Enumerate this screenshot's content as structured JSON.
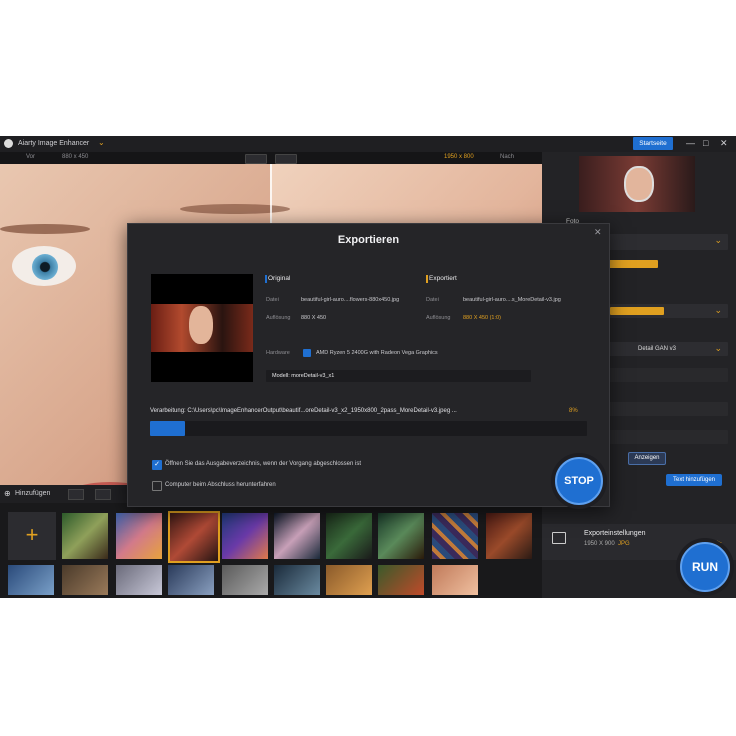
{
  "app": {
    "title": "Aiarty Image Enhancer",
    "start_button": "Startseite",
    "window_controls": [
      "—",
      "□",
      "✕"
    ]
  },
  "viewbar": {
    "left_tab": "Vor",
    "left_size": "880 x 450",
    "right_size": "1950 x 800",
    "right_tab": "Nach"
  },
  "right_panel": {
    "photo_label": "Foto",
    "dropdowns": [
      "",
      "",
      "",
      ""
    ],
    "yellow_tags": [
      "",
      "",
      ""
    ],
    "options": [
      "",
      "",
      ""
    ],
    "model_label": "Detail GAN v3",
    "section_labels": [
      "",
      "",
      ""
    ],
    "show_btn": "Anzeigen",
    "add_text_btn": "Text hinzufügen"
  },
  "export_settings": {
    "title": "Exporteinstellungen",
    "size": "1950 X 900",
    "format": "JPG"
  },
  "bottom": {
    "add_label": "Hinzufügen",
    "add_plus": "+"
  },
  "modal": {
    "title": "Exportieren",
    "original_header": "Original",
    "exported_header": "Exportiert",
    "file_key": "Datei",
    "original_file": "beautiful-girl-auro....flowers-880x450.jpg",
    "exported_file": "beautiful-girl-auro....s_MoreDetail-v3.jpg",
    "resolution_key": "Auflösung",
    "original_resolution": "880 X 450",
    "exported_resolution": "880 X 450 (1:0)",
    "hardware_key": "Hardware",
    "hardware_value": "AMD Ryzen 5 2400G with Radeon Vega Graphics",
    "model_label": "Modell: moreDetail-v3_x1",
    "processing": "Verarbeitung: C:\\Users\\pc\\ImageEnhancerOutput\\beautif...oreDetail-v3_x2_1950x800_2pass_MoreDetail-v3.jpeg ...",
    "percent": "8%",
    "progress": 0.08,
    "checkbox1": "Öffnen Sie das Ausgabeverzeichnis, wenn der Vorgang abgeschlossen ist",
    "checkbox2": "Computer beim Abschluss herunterfahren",
    "close": "✕"
  },
  "buttons": {
    "stop": "STOP",
    "run": "RUN"
  },
  "colors": {
    "accent": "#1f6fd1",
    "highlight": "#e0a020",
    "bg": "#1c1c1e"
  }
}
